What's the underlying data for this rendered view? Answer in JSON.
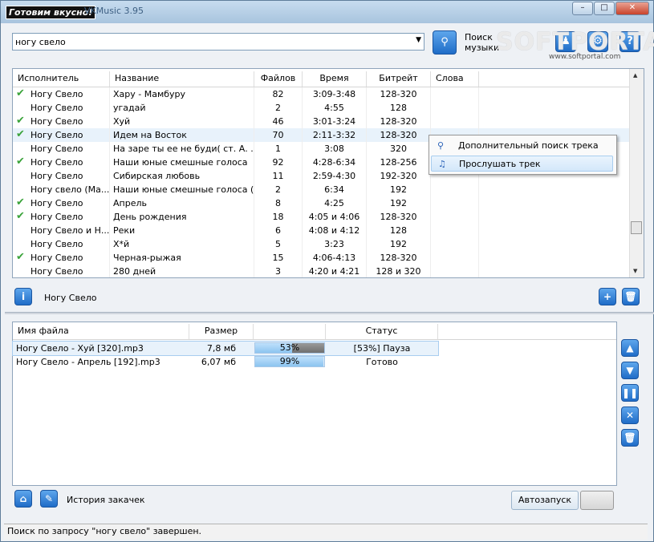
{
  "titlebar": {
    "badge": "Готовим вкусно!",
    "title_partial": "VKMusic 3.95"
  },
  "search": {
    "query": "ногу свело",
    "button_label": "Поиск музыки"
  },
  "watermark": {
    "text": "SOFTPORTAL",
    "url": "www.softportal.com"
  },
  "tracks": {
    "columns": [
      "Исполнитель",
      "Название",
      "Файлов",
      "Время",
      "Битрейт",
      "Слова"
    ],
    "rows": [
      {
        "artist": "Ногу Свело",
        "title": "Хару - Мамбуру",
        "files": "82",
        "time": "3:09-3:48",
        "bitrate": "128-320",
        "checked": true
      },
      {
        "artist": "Ногу Свело",
        "title": "угадай",
        "files": "2",
        "time": "4:55",
        "bitrate": "128",
        "checked": false
      },
      {
        "artist": "Ногу Свело",
        "title": "Хуй",
        "files": "46",
        "time": "3:01-3:24",
        "bitrate": "128-320",
        "checked": true
      },
      {
        "artist": "Ногу Свело",
        "title": "Идем на Восток",
        "files": "70",
        "time": "2:11-3:32",
        "bitrate": "128-320",
        "checked": true
      },
      {
        "artist": "Ногу Свело",
        "title": "На заре ты ее не буди( ст. А. ...",
        "files": "1",
        "time": "3:08",
        "bitrate": "320",
        "checked": false
      },
      {
        "artist": "Ногу Свело",
        "title": "Наши юные смешные голоса",
        "files": "92",
        "time": "4:28-6:34",
        "bitrate": "128-256",
        "checked": true
      },
      {
        "artist": "Ногу Свело",
        "title": "Сибирская любовь",
        "files": "11",
        "time": "2:59-4:30",
        "bitrate": "192-320",
        "checked": false
      },
      {
        "artist": "Ногу свело (Ма...",
        "title": "Наши юные смешные голоса (...",
        "files": "2",
        "time": "6:34",
        "bitrate": "192",
        "checked": false
      },
      {
        "artist": "Ногу Свело",
        "title": "Апрель",
        "files": "8",
        "time": "4:25",
        "bitrate": "192",
        "checked": true
      },
      {
        "artist": "Ногу Свело",
        "title": "День рождения",
        "files": "18",
        "time": "4:05 и 4:06",
        "bitrate": "128-320",
        "checked": true
      },
      {
        "artist": "Ногу Свело и Н...",
        "title": "Реки",
        "files": "6",
        "time": "4:08 и 4:12",
        "bitrate": "128",
        "checked": false
      },
      {
        "artist": "Ногу Свело",
        "title": "Х*й",
        "files": "5",
        "time": "3:23",
        "bitrate": "192",
        "checked": false
      },
      {
        "artist": "Ногу Свело",
        "title": "Черная-рыжая",
        "files": "15",
        "time": "4:06-4:13",
        "bitrate": "128-320",
        "checked": true
      },
      {
        "artist": "Ногу Свело",
        "title": "280 дней",
        "files": "3",
        "time": "4:20 и 4:21",
        "bitrate": "128 и 320",
        "checked": false
      }
    ]
  },
  "context_menu": {
    "items": [
      "Дополнительный поиск трека",
      "Прослушать трек"
    ]
  },
  "info": {
    "artist": "Ногу Свело"
  },
  "downloads": {
    "columns": [
      "Имя файла",
      "Размер",
      "",
      "Статус"
    ],
    "rows": [
      {
        "name": "Ногу Свело - Хуй [320].mp3",
        "size": "7,8 мб",
        "progress_label": "53%",
        "progress": 53,
        "status": "[53%] Пауза"
      },
      {
        "name": "Ногу Свело - Апрель [192].mp3",
        "size": "6,07 мб",
        "progress_label": "99%",
        "progress": 99,
        "status": "Готово"
      }
    ]
  },
  "bottom": {
    "history_label": "История закачек",
    "autostart_label": "Автозапуск"
  },
  "status_bar": "Поиск по запросу \"ногу свело\" завершен."
}
